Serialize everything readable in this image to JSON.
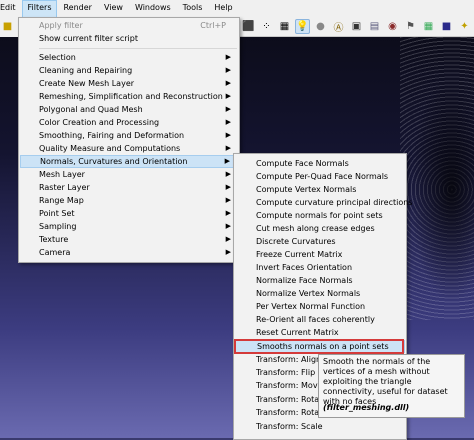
{
  "menubar": {
    "items": [
      "Edit",
      "Filters",
      "Render",
      "View",
      "Windows",
      "Tools",
      "Help"
    ]
  },
  "filters_menu": {
    "items": [
      {
        "label": "Apply filter",
        "shortcut": "Ctrl+P",
        "disabled": true
      },
      {
        "label": "Show current filter script"
      },
      {
        "label": "Selection",
        "submenu": true
      },
      {
        "label": "Cleaning and Repairing",
        "submenu": true
      },
      {
        "label": "Create New Mesh Layer",
        "submenu": true
      },
      {
        "label": "Remeshing, Simplification and Reconstruction",
        "submenu": true
      },
      {
        "label": "Polygonal and Quad Mesh",
        "submenu": true
      },
      {
        "label": "Color Creation and Processing",
        "submenu": true
      },
      {
        "label": "Smoothing, Fairing and Deformation",
        "submenu": true
      },
      {
        "label": "Quality Measure and Computations",
        "submenu": true
      },
      {
        "label": "Normals, Curvatures and Orientation",
        "submenu": true,
        "active": true
      },
      {
        "label": "Mesh Layer",
        "submenu": true
      },
      {
        "label": "Raster Layer",
        "submenu": true
      },
      {
        "label": "Range Map",
        "submenu": true
      },
      {
        "label": "Point Set",
        "submenu": true
      },
      {
        "label": "Sampling",
        "submenu": true
      },
      {
        "label": "Texture",
        "submenu": true
      },
      {
        "label": "Camera",
        "submenu": true
      }
    ]
  },
  "normals_submenu": {
    "items": [
      "Compute Face Normals",
      "Compute Per-Quad Face Normals",
      "Compute Vertex Normals",
      "Compute curvature principal directions",
      "Compute normals for point sets",
      "Cut mesh along crease edges",
      "Discrete Curvatures",
      "Freeze Current Matrix",
      "Invert Faces Orientation",
      "Normalize Face Normals",
      "Normalize Vertex Normals",
      "Per Vertex Normal Function",
      "Re-Orient all faces coherently",
      "Reset Current Matrix",
      "Smooths normals on a point sets",
      "Transform: Align to",
      "Transform: Flip and",
      "Transform: Move,",
      "Transform: Rotate",
      "Transform: Rotate",
      "Transform: Scale"
    ],
    "highlighted": "Smooths normals on a point sets"
  },
  "tooltip": {
    "text": "Smooth the normals of the vertices of a mesh without exploiting the triangle connectivity, useful for dataset with no faces",
    "file": "(filter_meshing.dll)"
  },
  "toolbar_icons": [
    "cube-icon",
    "dots-icon",
    "mesh-icon",
    "lightbulb-icon",
    "sphere-icon",
    "annotate-icon",
    "mesh-dark-icon",
    "image-icon",
    "camera-icon",
    "flag-icon",
    "grid-icon",
    "square-icon",
    "star-icon"
  ],
  "colors": {
    "highlight_border": "#d43a3a",
    "menu_hover": "#cce3f6"
  }
}
